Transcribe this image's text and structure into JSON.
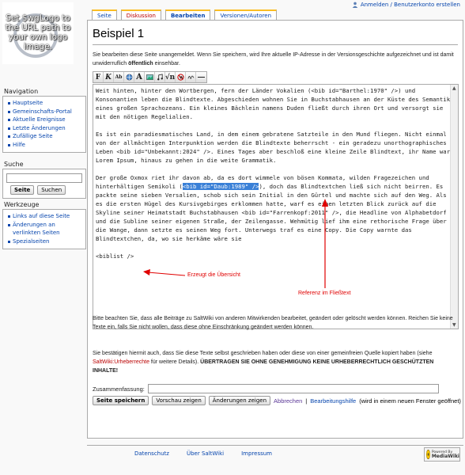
{
  "user_bar": {
    "label": "Anmelden / Benutzerkonto erstellen",
    "icon": "user-icon"
  },
  "logo": {
    "text": "Set $wgLogo to the URL path to your own logo image."
  },
  "sidebar": {
    "navigation": {
      "title": "Navigation",
      "items": [
        "Hauptseite",
        "Gemeinschafts-Portal",
        "Aktuelle Ereignisse",
        "Letzte Änderungen",
        "Zufällige Seite",
        "Hilfe"
      ]
    },
    "search": {
      "title": "Suche",
      "go_label": "Seite",
      "search_label": "Suchen"
    },
    "toolbox": {
      "title": "Werkzeuge",
      "items": [
        "Links auf diese Seite",
        "Änderungen an verlinkten Seiten",
        "Spezialseiten"
      ]
    }
  },
  "tabs": [
    {
      "label": "Seite",
      "state": "normal"
    },
    {
      "label": "Diskussion",
      "state": "new"
    },
    {
      "label": "Bearbeiten",
      "state": "selected"
    },
    {
      "label": "Versionen/Autoren",
      "state": "normal"
    }
  ],
  "page": {
    "title": "Beispiel 1",
    "warning": {
      "part1": "Sie bearbeiten diese Seite unangemeldet. Wenn Sie speichern, wird Ihre aktuelle IP-Adresse in der Versionsgeschichte aufgezeichnet und ist damit unwiderruflich ",
      "strong": "öffentlich",
      "part2": " einsehbar."
    }
  },
  "toolbar": {
    "buttons": [
      "bold",
      "italic",
      "internal-link",
      "external-link",
      "headline",
      "image",
      "media",
      "math",
      "nowiki",
      "signature",
      "horizontal-line"
    ]
  },
  "editor": {
    "p1": "Weit hinten, hinter den Wortbergen, fern der Länder Vokalien (<bib id=\"Barthel:1970\" />) und Konsonantien leben die Blindtexte. Abgeschieden wohnen Sie in Buchstabhausen an der Küste des Semantik, eines großen Sprachozeans. Ein kleines Bächlein namens Duden fließt durch ihren Ort und versorgt sie mit den nötigen Regelialien.",
    "p2": "Es ist ein paradiesmatisches Land, in dem einem gebratene Satzteile in den Mund fliegen. Nicht einmal von der allmächtigen Interpunktion werden die Blindtexte beherrscht - ein geradezu unorthographisches Leben <bib id=\"Unbekannt:2024\" />. Eines Tages aber beschloß eine kleine Zeile Blindtext, ihr Name war Lorem Ipsum, hinaus zu gehen in die weite Grammatik.",
    "p3_before": "Der große Oxmox riet ihr davon ab, da es dort wimmele von bösen Kommata, wilden Fragezeichen und hinterhältigen Semikoli (",
    "p3_highlight": "<bib id=\"Daub:1989\" />",
    "p3_after": "), doch das Blindtextchen ließ sich nicht beirren. Es packte seine sieben Versalien, schob sich sein Initial in den Gürtel und machte sich auf den Weg. Als es die ersten Hügel des Kursivgebirges erklommen hatte, warf es einen letzten Blick zurück auf die Skyline seiner Heimatstadt Buchstabhausen <bib id=\"Farrenkopf:2011\" />, die Headline von Alphabetdorf und die Subline seiner eigenen Straße, der Zeilengasse. Wehmütig lief ihm eine rethorische Frage über die Wange, dann setzte es seinen Weg fort. Unterwegs traf es eine Copy. Die Copy warnte das Blindtextchen, da, wo sie herkäme wäre sie",
    "p4": "<biblist />"
  },
  "annotations": {
    "biblist_note": "Erzeugt die Übersicht",
    "reference_note": "Referenz im Fließtext"
  },
  "notices": {
    "license": "Bitte beachten Sie, dass alle Beiträge zu SaltWiki von anderen Mitwirkenden bearbeitet, geändert oder gelöscht werden können. Reichen Sie keine Texte ein, falls Sie nicht wollen, dass diese ohne Einschränkung geändert werden können.",
    "copyright_p1": "Sie bestätigen hiermit auch, dass Sie diese Texte selbst geschrieben haben oder diese von einer gemeinfreien Quelle kopiert haben (siehe ",
    "copyright_link": "SaltWiki:Urheberrechte",
    "copyright_p2": " für weitere Details). ",
    "copyright_strong": "ÜBERTRAGEN SIE OHNE GENEHMIGUNG KEINE URHEBERRECHTLICH GESCHÜTZTEN INHALTE!"
  },
  "summary": {
    "label": "Zusammenfassung:",
    "value": ""
  },
  "actions": {
    "save": "Seite speichern",
    "preview": "Vorschau zeigen",
    "diff": "Änderungen zeigen",
    "cancel": "Abbrechen",
    "separator": "|",
    "help": "Bearbeitungshilfe",
    "help_note": "(wird in einem neuen Fenster geöffnet)"
  },
  "footer": {
    "links": [
      "Datenschutz",
      "Über SaltWiki",
      "Impressum"
    ],
    "badge": {
      "top": "Powered By",
      "brand": "MediaWiki"
    }
  },
  "colors": {
    "accent_tab": "#fabd23",
    "link": "#0645ad",
    "new_link": "#ba0000",
    "annotation": "#e00000",
    "selection": "#3a80d7"
  }
}
